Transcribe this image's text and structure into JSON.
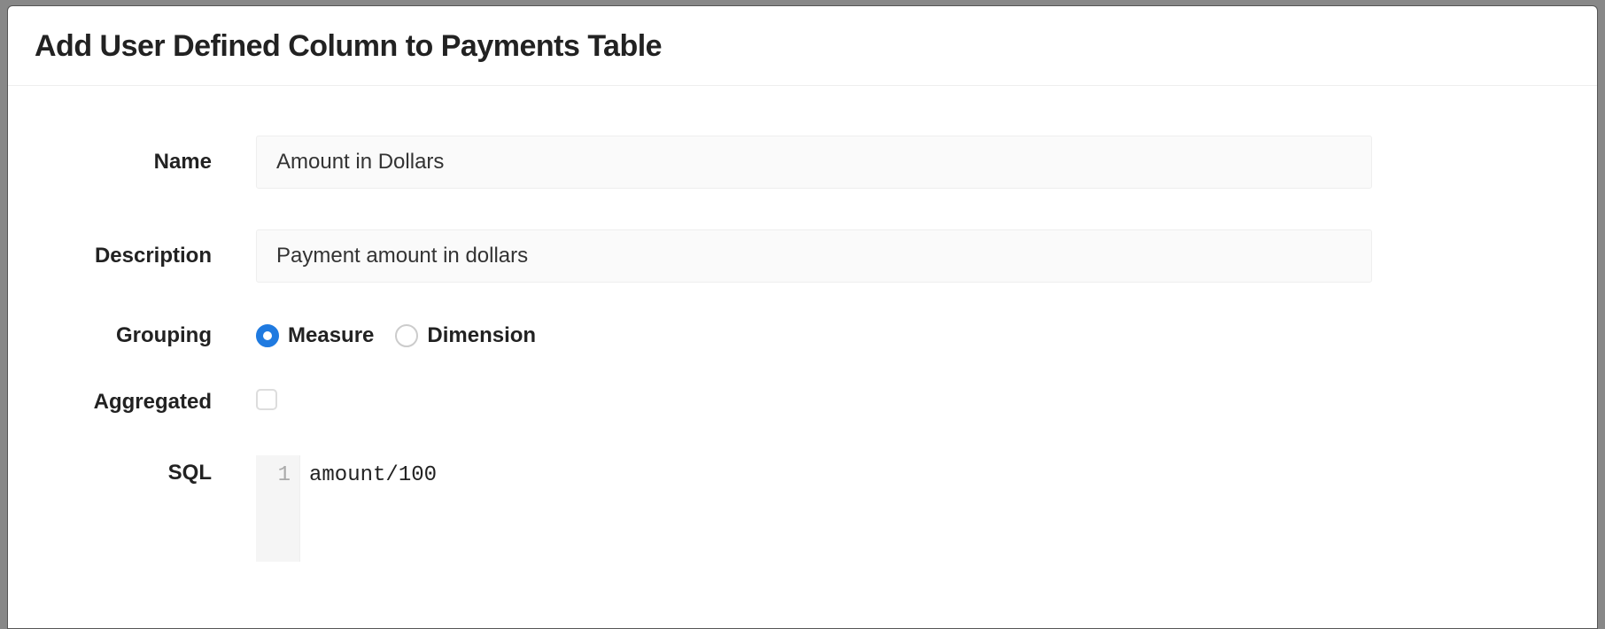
{
  "modal": {
    "title": "Add User Defined Column to Payments Table"
  },
  "form": {
    "name_label": "Name",
    "name_value": "Amount in Dollars",
    "description_label": "Description",
    "description_value": "Payment amount in dollars",
    "grouping_label": "Grouping",
    "grouping_options": {
      "measure": "Measure",
      "dimension": "Dimension"
    },
    "grouping_selected": "measure",
    "aggregated_label": "Aggregated",
    "aggregated_checked": false,
    "sql_label": "SQL",
    "sql_line_number": "1",
    "sql_value": "amount/100"
  }
}
